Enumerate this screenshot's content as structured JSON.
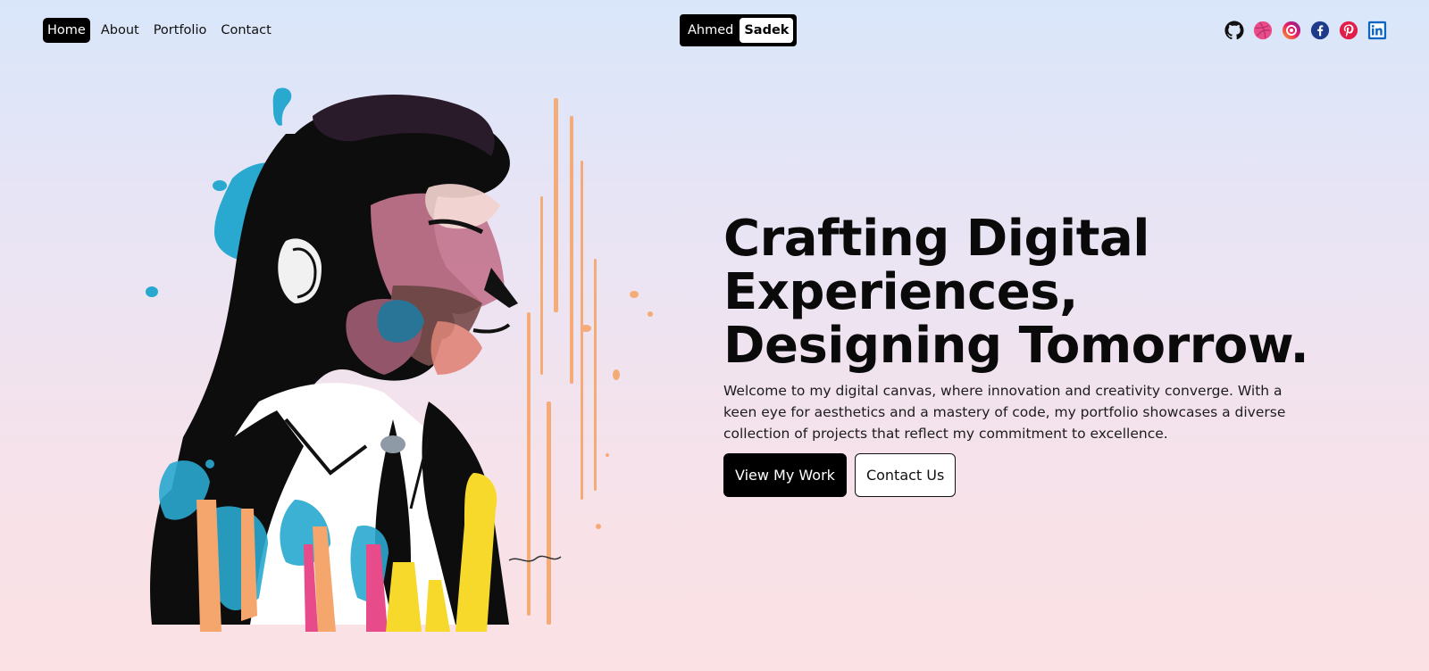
{
  "nav": {
    "links": [
      {
        "label": "Home",
        "active": true
      },
      {
        "label": "About",
        "active": false
      },
      {
        "label": "Portfolio",
        "active": false
      },
      {
        "label": "Contact",
        "active": false
      }
    ]
  },
  "brand": {
    "first": "Ahmed",
    "last": "Sadek"
  },
  "socials": [
    {
      "name": "github-icon",
      "color": "#111111"
    },
    {
      "name": "dribbble-icon",
      "color": "#ea4c89"
    },
    {
      "name": "instagram-icon",
      "color": "#c13584"
    },
    {
      "name": "facebook-icon",
      "color": "#1d4ed8"
    },
    {
      "name": "pinterest-icon",
      "color": "#e11d48"
    },
    {
      "name": "linkedin-icon",
      "color": "#0a66c2"
    }
  ],
  "hero": {
    "headline": [
      "Crafting Digital",
      "Experiences,",
      "Designing Tomorrow."
    ],
    "description": "Welcome to my digital canvas, where innovation and creativity converge. With a keen eye for aesthetics and a mastery of code, my portfolio showcases a diverse collection of projects that reflect my commitment to excellence.",
    "primary_cta": "View My Work",
    "secondary_cta": "Contact Us"
  },
  "colors": {
    "accent": "#000000",
    "bg_top": "#d9e6fa",
    "bg_bottom": "#fbe1e4"
  }
}
